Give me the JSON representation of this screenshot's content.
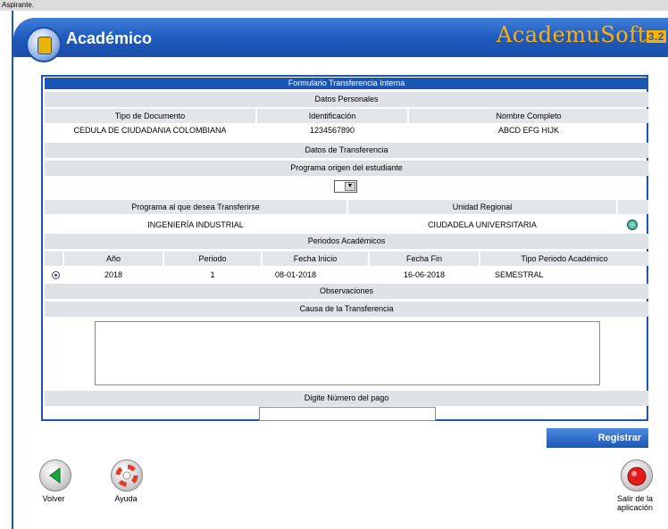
{
  "window": {
    "title": "Aspirante."
  },
  "header": {
    "title": "Académico",
    "brand": "AcademuSoft",
    "brand_version": "3.2"
  },
  "form": {
    "title": "Formulario Transferencia Interna",
    "personal": {
      "section": "Datos Personales",
      "headers": [
        "Tipo de Documento",
        "Identificación",
        "Nombre Completo"
      ],
      "values": [
        "CEDULA DE CIUDADANIA COLOMBIANA",
        "1234567890",
        "ABCD EFG HIJK"
      ]
    },
    "transfer": {
      "section": "Datos de Transferencia",
      "origin_label": "Programa origen del estudiante",
      "target_header": "Programa al que desea Transferirse",
      "regional_header": "Unidad Regional",
      "target_value": "INGENIERÍA INDUSTRIAL",
      "regional_value": "CIUDADELA UNIVERSITARIA"
    },
    "periods": {
      "section": "Periodos Académicos",
      "headers": [
        "Año",
        "Periodo",
        "Fecha Inicio",
        "Fecha Fin",
        "Tipo Periodo Académico"
      ],
      "row": [
        "2018",
        "1",
        "08-01-2018",
        "16-06-2018",
        "SEMESTRAL"
      ]
    },
    "observations": {
      "section": "Observaciones",
      "cause_label": "Causa de la Transferencia"
    },
    "payment": {
      "label": "Digite Número del pago",
      "value": ""
    }
  },
  "buttons": {
    "submit": "Registrar",
    "back": "Volver",
    "help": "Ayuda",
    "exit": "Salir de la aplicación"
  },
  "colors": {
    "accent": "#1a56b4",
    "brand": "#ffb000",
    "section_grey": "#dfe2e7"
  }
}
